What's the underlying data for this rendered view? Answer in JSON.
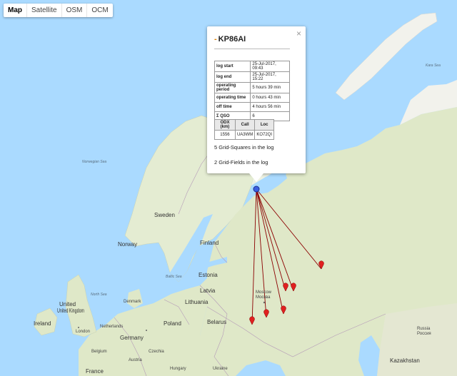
{
  "map_types": [
    {
      "label": "Map",
      "active": true
    },
    {
      "label": "Satellite",
      "active": false
    },
    {
      "label": "OSM",
      "active": false
    },
    {
      "label": "OCM",
      "active": false
    }
  ],
  "popup": {
    "title": "KP86AI",
    "close_symbol": "×",
    "log_rows": [
      {
        "key": "log start",
        "value": "25-Jul-2017, 09:43"
      },
      {
        "key": "log end",
        "value": "25-Jul-2017, 15:22"
      },
      {
        "key": "operating period",
        "value": "5 hours 39 min"
      },
      {
        "key": "operating time",
        "value": "0 hours 43 min"
      },
      {
        "key": "off time",
        "value": "4 hours 56 min"
      },
      {
        "key": "Σ QSO",
        "value": "6"
      }
    ],
    "odx_headers": [
      "ODX (km)",
      "Call",
      "Loc"
    ],
    "odx_row": [
      "1556",
      "UA3WM",
      "KO72QI"
    ],
    "grid_squares": "5 Grid-Squares in the log",
    "grid_fields": "2 Grid-Fields in the log"
  },
  "labels": {
    "norwegian_sea": "Norwegian Sea",
    "kara_sea": "Kara Sea",
    "north_sea": "North Sea",
    "baltic_sea": "Baltic Sea",
    "sweden": "Sweden",
    "norway": "Norway",
    "finland": "Finland",
    "estonia": "Estonia",
    "latvia": "Latvia",
    "lithuania": "Lithuania",
    "denmark": "Denmark",
    "uk": "United Kingdom",
    "ireland": "Ireland",
    "london": "London",
    "netherlands": "Netherlands",
    "belgium": "Belgium",
    "germany": "Germany",
    "poland": "Poland",
    "belarus": "Belarus",
    "czechia": "Czechia",
    "france": "France",
    "austria": "Austria",
    "hungary": "Hungary",
    "ukraine": "Ukraine",
    "kazakhstan": "Kazakhstan",
    "moscow": "Moscow",
    "moscow_ru": "Москва",
    "russia": "Russia",
    "russia_ru": "Россия"
  },
  "colors": {
    "sea": "#aadaff",
    "land": "#dfe8c8",
    "land_north": "#f2f2ec",
    "line": "#8b0000",
    "marker": "#e02020",
    "home": "#3b5fe0"
  }
}
